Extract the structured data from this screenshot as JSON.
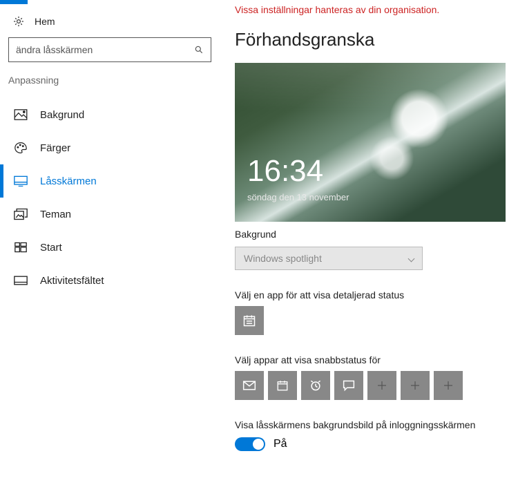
{
  "sidebar": {
    "home_label": "Hem",
    "search_value": "ändra låsskärmen",
    "category": "Anpassning",
    "items": [
      {
        "label": "Bakgrund"
      },
      {
        "label": "Färger"
      },
      {
        "label": "Låsskärmen"
      },
      {
        "label": "Teman"
      },
      {
        "label": "Start"
      },
      {
        "label": "Aktivitetsfältet"
      }
    ]
  },
  "content": {
    "warning": "Vissa inställningar hanteras av din organisation.",
    "preview_title": "Förhandsgranska",
    "preview_time": "16:34",
    "preview_date": "söndag den 13 november",
    "bg_label": "Bakgrund",
    "bg_value": "Windows spotlight",
    "detail_label": "Välj en app för att visa detaljerad status",
    "quick_label": "Välj appar att visa snabbstatus för",
    "signin_label": "Visa låsskärmens bakgrundsbild på inloggningsskärmen",
    "toggle_state": "På"
  }
}
